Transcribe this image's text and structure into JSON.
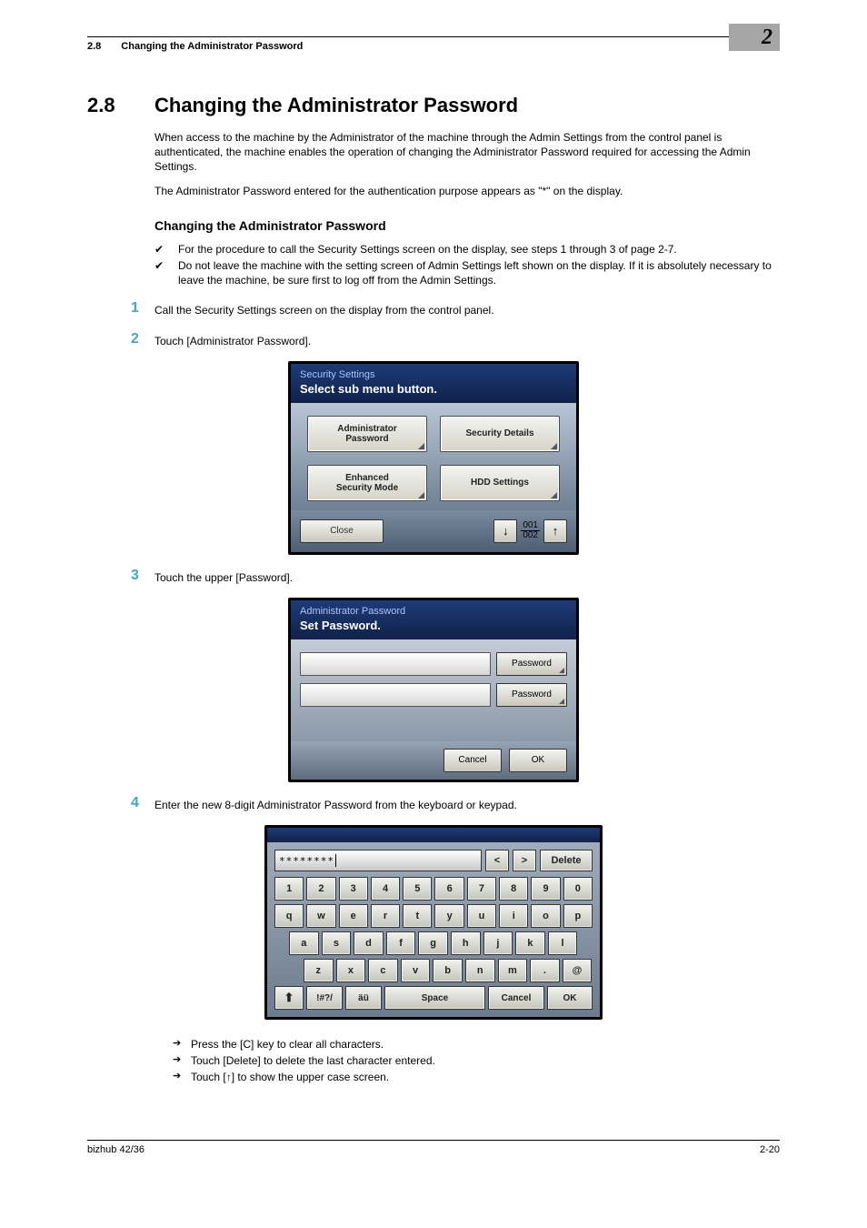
{
  "header": {
    "section_num": "2.8",
    "section_title": "Changing the Administrator Password",
    "chapter": "2"
  },
  "h1": {
    "num": "2.8",
    "text": "Changing the Administrator Password"
  },
  "intro1": "When access to the machine by the Administrator of the machine through the Admin Settings from the control panel is authenticated, the machine enables the operation of changing the Administrator Password required for accessing the Admin Settings.",
  "intro2": "The Administrator Password entered for the authentication purpose appears as \"*\" on the display.",
  "h2": "Changing the Administrator Password",
  "checks": [
    "For the procedure to call the Security Settings screen on the display, see steps 1 through 3 of page 2-7.",
    "Do not leave the machine with the setting screen of Admin Settings left shown on the display. If it is absolutely necessary to leave the machine, be sure first to log off from the Admin Settings."
  ],
  "steps": {
    "s1": {
      "n": "1",
      "t": "Call the Security Settings screen on the display from the control panel."
    },
    "s2": {
      "n": "2",
      "t": "Touch [Administrator Password]."
    },
    "s3": {
      "n": "3",
      "t": "Touch the upper [Password]."
    },
    "s4": {
      "n": "4",
      "t": "Enter the new 8-digit Administrator Password from the keyboard or keypad."
    }
  },
  "panel1": {
    "title": "Security Settings",
    "subtitle": "Select sub menu button.",
    "btn_admin_l1": "Administrator",
    "btn_admin_l2": "Password",
    "btn_secdet": "Security Details",
    "btn_enh_l1": "Enhanced",
    "btn_enh_l2": "Security Mode",
    "btn_hdd": "HDD Settings",
    "close": "Close",
    "page_cur": "001",
    "page_tot": "002"
  },
  "panel2": {
    "title": "Administrator Password",
    "subtitle": "Set Password.",
    "password_label": "Password",
    "cancel": "Cancel",
    "ok": "OK"
  },
  "kb": {
    "display": "********",
    "lt": "<",
    "gt": ">",
    "delete": "Delete",
    "row1": [
      "1",
      "2",
      "3",
      "4",
      "5",
      "6",
      "7",
      "8",
      "9",
      "0"
    ],
    "row2": [
      "q",
      "w",
      "e",
      "r",
      "t",
      "y",
      "u",
      "i",
      "o",
      "p"
    ],
    "row3": [
      "a",
      "s",
      "d",
      "f",
      "g",
      "h",
      "j",
      "k",
      "l"
    ],
    "row4": [
      "z",
      "x",
      "c",
      "v",
      "b",
      "n",
      "m",
      ".",
      "@"
    ],
    "shift_sym": "⬆",
    "symkey": "!#?/",
    "accent": "äü",
    "space": "Space",
    "cancel": "Cancel",
    "ok": "OK"
  },
  "tips": [
    "Press the [C] key to clear all characters.",
    "Touch [Delete] to delete the last character entered.",
    "Touch [ ] to show the upper case screen."
  ],
  "tip3_pre": "Touch [",
  "tip3_post": "] to show the upper case screen.",
  "footer": {
    "left": "bizhub 42/36",
    "right": "2-20"
  }
}
